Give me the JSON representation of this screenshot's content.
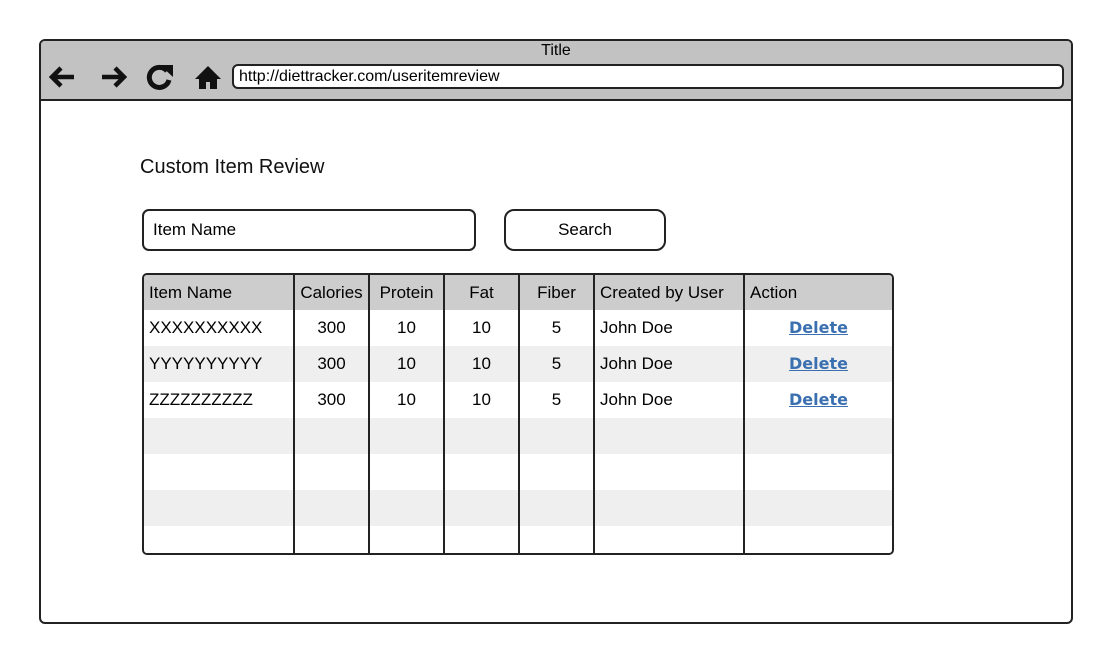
{
  "window": {
    "title": "Title"
  },
  "browser": {
    "url": "http://diettracker.com/useritemreview",
    "icons": [
      "back-arrow-icon",
      "forward-arrow-icon",
      "reload-icon",
      "home-icon"
    ]
  },
  "page": {
    "heading": "Custom Item Review"
  },
  "search": {
    "placeholder": "Item Name",
    "value": "",
    "button_label": "Search"
  },
  "table": {
    "columns": [
      "Item Name",
      "Calories",
      "Protein",
      "Fat",
      "Fiber",
      "Created by User",
      "Action"
    ],
    "rows": [
      {
        "item_name": "XXXXXXXXXX",
        "calories": "300",
        "protein": "10",
        "fat": "10",
        "fiber": "5",
        "created_by": "John Doe",
        "action": "Delete"
      },
      {
        "item_name": "YYYYYYYYYY",
        "calories": "300",
        "protein": "10",
        "fat": "10",
        "fiber": "5",
        "created_by": "John Doe",
        "action": "Delete"
      },
      {
        "item_name": "ZZZZZZZZZZ",
        "calories": "300",
        "protein": "10",
        "fat": "10",
        "fiber": "5",
        "created_by": "John Doe",
        "action": "Delete"
      }
    ],
    "empty_row_count": 4
  },
  "colors": {
    "titlebar": "#c2c2c2",
    "table_header": "#cdcdcd",
    "row_stripe": "#efefef",
    "link": "#3a6fb0"
  }
}
